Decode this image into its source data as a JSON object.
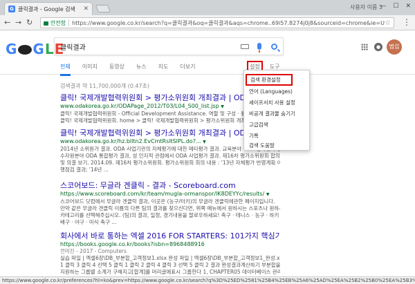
{
  "browser": {
    "tab_title": "클릭결과 - Google 검색",
    "tab_favicon_letter": "G",
    "profile_name": "사용자 이름 3",
    "secure_label": "안전함",
    "url": "https://www.google.co.kr/search?q=클릭결과&oq=클릭결과&aqs=chrome..69i57.8274j0j8&sourceid=chrome&ie=UTF-8"
  },
  "google": {
    "query": "클릭결과",
    "avatar_label": "범섭",
    "tabs": [
      "전체",
      "이미지",
      "동영상",
      "뉴스",
      "지도",
      "더보기"
    ],
    "settings_label": "설정",
    "tools_label": "도구",
    "stats": "검색결과 약 11,700,000개 (0.47초)"
  },
  "settings_menu": {
    "items": [
      "검색 환경설정",
      "언어 (Languages)",
      "세이프서치 사용 설정",
      "비공개 결과물 숨기기",
      "고급검색",
      "기록",
      "검색 도움말"
    ]
  },
  "results": [
    {
      "title": "클릭! 국제개발협력위원회 > 평가소위원회 개최결과 | ODA KOR",
      "url": "www.odakorea.go.kr/ODAPage_2012/T03/L04_S00_list.jsp",
      "snippet": [
        "클릭! 국제개발협력위원회 - Official Development Assistance. 역할 및 구성 · 활동현황 및 ...",
        "클릭! 국제개발협력위원회. home > 클릭! 국제개발협력위원회 > 평가소위원회 개최결과 인쇄 ..."
      ]
    },
    {
      "title": "클릭! 국제개발협력위원회 > 평가소위원회 개최결과 | ODA KOR",
      "url": "www.odakorea.go.kr/hz.blltn2.EvCmtRsltSlPL.do?...",
      "snippet": [
        "2014년 소위원가 결과. ODA 사업기관의 자체평가에 대한 메타평가 결과. 교육분야 ODA 성과평가 결과,",
        "수자원분야 ODA 통합평가 결과, 성 인지적 관점에서 ODA 사업평가 결과. 제16차 평가소위원회 합의",
        "및 의결 보기. 2014.09. 제16차 평가소위원회. 평가소위원회 회의 내용 : '13년 자체평가 반영계획 이",
        "행점검 결과; '14년 ..."
      ]
    },
    {
      "title": "스코어보드: 무글라 겐클릭 - 결과 - Scoreboard.com",
      "url": "https://www.scoreboard.com/kr/team/mugla-ormanspor/lK8DEYYc/results/",
      "snippet": [
        "스코어보드 닷컴에서 무글라 겐클릭 결과, 이곳은 (농구/터키)의 무글라 겐클릭에관한 페이지입니다.",
        "만약 같은 무글라 겐클릭 이름의 다른 팀의 결과를 찾으신다면, 위쪽 메뉴에서 원하시는 스포츠나 원하시",
        "카테고리를 선택해주십시오. (팀)의 결과, 일정, 경기내용을 팔로우하세요! 축구 · 테니스 · 농구 · 하키 ·",
        "배구 · 야구 · 미식 축구 ..."
      ]
    },
    {
      "title": "회사에서 바로 통하는 엑셀 2016 FOR STARTERS: 101가지 핵심기능으...",
      "url": "https://books.google.co.kr/books?isbn=8968488916",
      "meta": [
        "전미진 - 2017 - Computers"
      ],
      "snippet": [
        "실습 파일 | 엑셀6장\\DB_부분합_고객정보1.xlsx 완성 파일 | 엑셀6장\\DB_부분합_고객정보1_완성.xlsx",
        "1 클릭 3 클릭 4 선택 5 클릭 1 클릭 2 클릭 4 클릭 3 선택 5 클릭 2 결과 완성결과계산하기 부분합을",
        "지원하는 그룹별 소계가 구해지고[합계]를 머리글에표시 그룹한다 1, CHAPTER05 데이터베이스 관리..."
      ]
    }
  ],
  "statusbar": "https://www.google.co.kr/preferences?hl=ko&prev=https://www.google.co.kr/search?q%3D%25ED%2581%25B4%25EB%25A6%25AD%25EA%25B2%25B0%25EA%25B3%25BC%26oq%3D%25ED%2581%2..."
}
